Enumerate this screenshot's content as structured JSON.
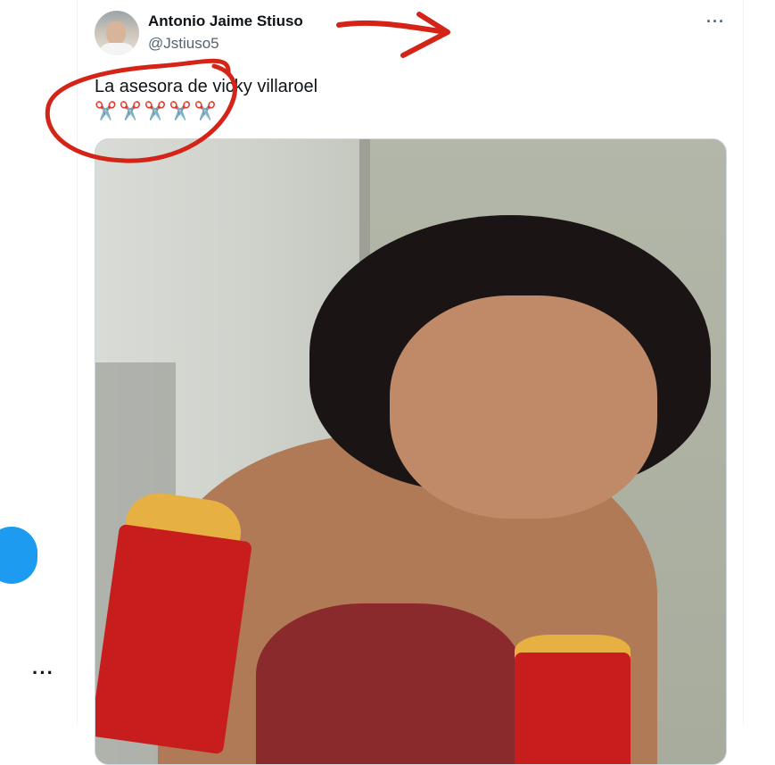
{
  "user": {
    "display_name": "Antonio Jaime Stiuso",
    "handle": "@Jstiuso5"
  },
  "tweet": {
    "text": "La asesora de vicky villaroel",
    "emoji_row": "✂️✂️✂️✂️✂️"
  },
  "ui": {
    "more_label": "···",
    "left_more_label": "···"
  },
  "colors": {
    "accent": "#1d9bf0",
    "annotation": "#d42418"
  },
  "icons": {
    "avatar": "profile-photo",
    "more": "ellipsis-icon",
    "annotation_arrow": "arrow",
    "annotation_circle": "circle"
  }
}
